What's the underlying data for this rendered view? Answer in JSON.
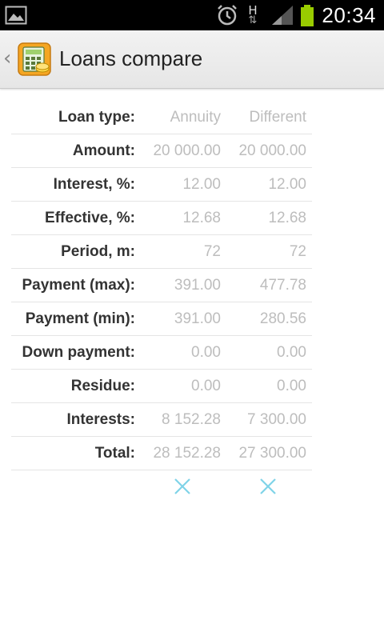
{
  "status_bar": {
    "time": "20:34",
    "network_letter": "H",
    "icons": [
      "gallery-icon",
      "alarm-icon",
      "data-transfer-icon",
      "signal-icon",
      "battery-icon"
    ],
    "battery_color": "#99cc00"
  },
  "action_bar": {
    "title": "Loans compare",
    "app_icon": "calculator-icon"
  },
  "comparison": {
    "columns": [
      "Annuity",
      "Different"
    ],
    "rows": [
      {
        "label": "Loan type:",
        "a": "Annuity",
        "b": "Different"
      },
      {
        "label": "Amount:",
        "a": "20 000.00",
        "b": "20 000.00"
      },
      {
        "label": "Interest, %:",
        "a": "12.00",
        "b": "12.00"
      },
      {
        "label": "Effective, %:",
        "a": "12.68",
        "b": "12.68"
      },
      {
        "label": "Period, m:",
        "a": "72",
        "b": "72"
      },
      {
        "label": "Payment (max):",
        "a": "391.00",
        "b": "477.78"
      },
      {
        "label": "Payment (min):",
        "a": "391.00",
        "b": "280.56"
      },
      {
        "label": "Down payment:",
        "a": "0.00",
        "b": "0.00"
      },
      {
        "label": "Residue:",
        "a": "0.00",
        "b": "0.00"
      },
      {
        "label": "Interests:",
        "a": "8 152.28",
        "b": "7 300.00"
      },
      {
        "label": "Total:",
        "a": "28 152.28",
        "b": "27 300.00"
      }
    ]
  },
  "colors": {
    "label": "#333333",
    "value": "#bdbdbd",
    "remove_icon": "#7fd3e8"
  }
}
